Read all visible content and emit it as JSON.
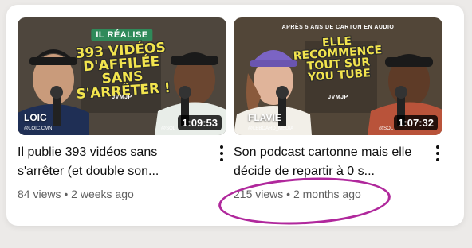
{
  "videos": [
    {
      "thumb_tag": "IL RÉALISE",
      "thumb_headline": [
        "393 VIDÉOS",
        "D'AFFILÉE",
        "SANS",
        "S'ARRÊTER !"
      ],
      "thumb_name": "LOIC",
      "thumb_handle": "@LOIC.CMN",
      "thumb_guest_handle": "@SOL",
      "thumb_mark": "JVMJP",
      "duration": "1:09:53",
      "title": "Il publie 393 vidéos sans s'arrêter (et double son...",
      "views": "84 views",
      "age": "2 weeks ago"
    },
    {
      "thumb_tag": "APRÈS 5 ANS DE CARTON EN AUDIO",
      "thumb_headline": [
        "ELLE",
        "RECOMMENCE",
        "TOUT SUR",
        "YOU TUBE"
      ],
      "thumb_name": "FLAVIE",
      "thumb_handle": "@LEBOARD_MEDIA",
      "thumb_guest_handle": "@SOL",
      "thumb_mark": "JVMJP",
      "duration": "1:07:32",
      "title": "Son podcast cartonne mais elle décide de repartir à 0 s...",
      "views": "215 views",
      "age": "2 months ago"
    }
  ],
  "separator": "•",
  "icons": {
    "more": "kebab-vertical-icon"
  },
  "colors": {
    "annotation": "#b0289c",
    "headline": "#f2e44e"
  }
}
